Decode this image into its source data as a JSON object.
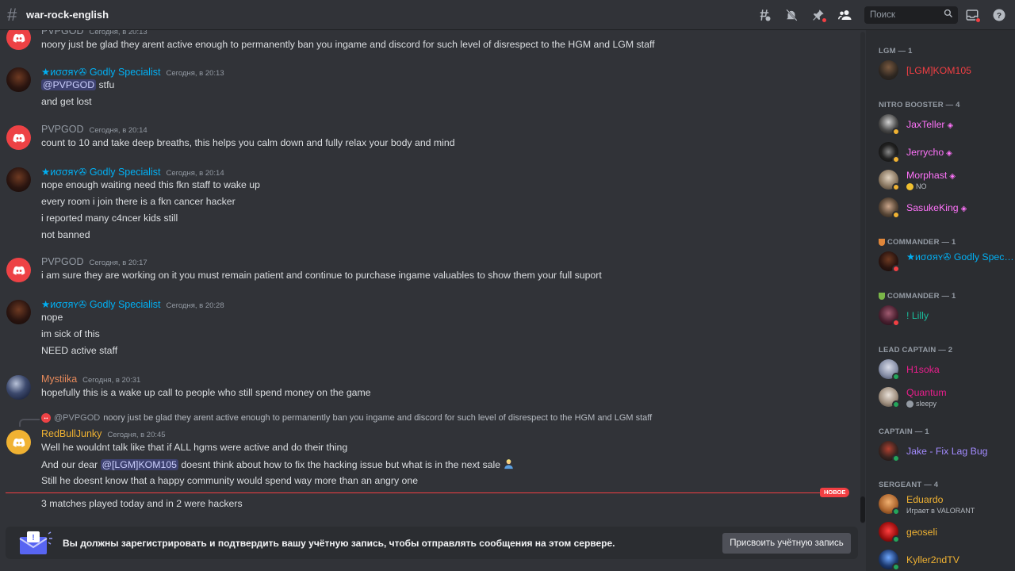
{
  "channel": {
    "name": "war-rock-english"
  },
  "header": {
    "search_placeholder": "Поиск"
  },
  "messages": [
    {
      "author": "PVPGOD",
      "time": "Сегодня, в 20:13",
      "lines": [
        "noory just be glad they arent active enough to permanently ban you ingame and discord for such level of disrespect to the HGM and LGM staff"
      ]
    },
    {
      "author": "★ᴎσσяʏ✇ Godly Specialist",
      "time": "Сегодня, в 20:13",
      "mention": "@PVPGOD",
      "mention_rest": " stfu",
      "lines": [
        "and get lost"
      ]
    },
    {
      "author": "PVPGOD",
      "time": "Сегодня, в 20:14",
      "lines": [
        "count to 10 and take deep breaths, this helps you calm down and fully relax your body and mind"
      ]
    },
    {
      "author": "★ᴎσσяʏ✇ Godly Specialist",
      "time": "Сегодня, в 20:14",
      "lines": [
        "nope enough waiting need this fkn staff to wake up",
        "every room i join there  is a fkn cancer hacker",
        "i reported many c4ncer kids still",
        "not banned"
      ]
    },
    {
      "author": "PVPGOD",
      "time": "Сегодня, в 20:17",
      "lines": [
        "i am sure they are working on it you must remain patient and continue to purchase ingame valuables to show them your full suport"
      ]
    },
    {
      "author": "★ᴎσσяʏ✇ Godly Specialist",
      "time": "Сегодня, в 20:28",
      "lines": [
        "nope",
        "im sick of this",
        "NEED active staff"
      ]
    },
    {
      "author": "Mystiika",
      "time": "Сегодня, в 20:31",
      "lines": [
        "hopefully this is a wake up call to people who still spend money on the game"
      ]
    },
    {
      "author": "RedBullJunky",
      "time": "Сегодня, в 20:45",
      "reply_to": "@PVPGOD",
      "reply_text": "noory just be glad they arent active enough to permanently ban you ingame and discord for such level of disrespect to the HGM and LGM staff",
      "line1": "Well he wouldnt talk like that if ALL hgms were active and do their thing",
      "line2_pre": "And our dear ",
      "line2_mention": "@[LGM]KOM105",
      "line2_post": " doesnt think about how to fix the hacking issue but what is in the next sale",
      "line3": "Still he doesnt know that a happy community would spend way more than an angry one",
      "line4": "3 matches played today and in 2 were hackers"
    }
  ],
  "new_marker": "НОВОЕ",
  "banner": {
    "text": "Вы должны зарегистрировать и подтвердить вашу учётную запись, чтобы отправлять сообщения на этом сервере.",
    "button": "Присвоить учётную запись"
  },
  "members": {
    "groups": [
      {
        "role": "LGM — 1",
        "items": [
          {
            "name": "[LGM]KOM105",
            "color": "#f23f43"
          }
        ]
      },
      {
        "role": "NITRO BOOSTER — 4",
        "items": [
          {
            "name": "JaxTeller",
            "color": "#ff73fa"
          },
          {
            "name": "Jerrycho",
            "color": "#ff73fa"
          },
          {
            "name": "Morphast",
            "color": "#ff73fa",
            "sub": "NO"
          },
          {
            "name": "SasukeKing",
            "color": "#ff73fa"
          }
        ]
      },
      {
        "role": "COMMANDER — 1",
        "items": [
          {
            "name": "★ᴎσσяʏ✇ Godly Specialist",
            "color": "#00b0f4"
          }
        ]
      },
      {
        "role": "COMMANDER — 1",
        "items": [
          {
            "name": "! Lilly",
            "color": "#1abc9c"
          }
        ]
      },
      {
        "role": "LEAD CAPTAIN — 2",
        "items": [
          {
            "name": "H1soka",
            "color": "#e91e8c"
          },
          {
            "name": "Quantum",
            "color": "#e91e8c",
            "sub": "sleepy"
          }
        ]
      },
      {
        "role": "CAPTAIN — 1",
        "items": [
          {
            "name": "Jake - Fix Lag Bug",
            "color": "#a38bff"
          }
        ]
      },
      {
        "role": "SERGEANT — 4",
        "items": [
          {
            "name": "Eduardo",
            "color": "#f0b232",
            "sub": "Играет в VALORANT"
          },
          {
            "name": "geoseli",
            "color": "#f0b232"
          },
          {
            "name": "Kyller2ndTV",
            "color": "#f0b232"
          }
        ]
      }
    ]
  },
  "colors": {
    "accent": "#5865f2",
    "new_marker": "#f23f43",
    "online": "#23a55a",
    "idle": "#f0b232",
    "dnd": "#f23f43"
  }
}
